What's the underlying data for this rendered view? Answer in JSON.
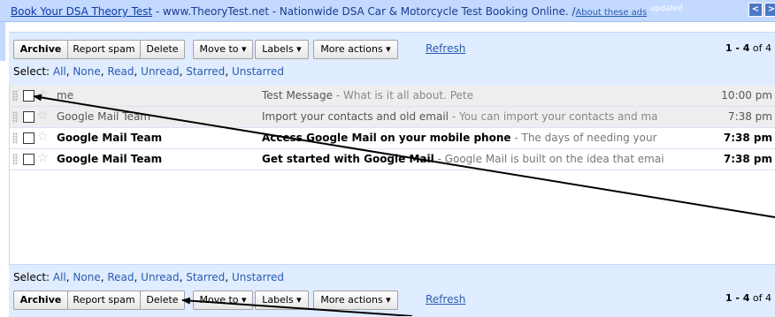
{
  "ad": {
    "link_text": "Book Your DSA Theory Test",
    "body": " - www.TheoryTest.net - Nationwide DSA Car & Motorcycle Test Booking Online. /",
    "about_text": "About these ads",
    "updated_text": "updated",
    "prev_icon": "chevron-left-icon",
    "next_icon": "chevron-right-icon"
  },
  "toolbar": {
    "archive": "Archive",
    "report_spam": "Report spam",
    "delete": "Delete",
    "move_to": "Move to ▾",
    "labels": "Labels ▾",
    "more_actions": "More actions ▾",
    "refresh": "Refresh",
    "count_range": "1 - 4",
    "count_total": "of 4"
  },
  "select": {
    "prefix": "Select: ",
    "all": "All",
    "none": "None",
    "read": "Read",
    "unread": "Unread",
    "starred": "Starred",
    "unstarred": "Unstarred",
    "sep": ", "
  },
  "messages": [
    {
      "sender": "me",
      "subject": "Test Message",
      "snippet": " - What is it all about. Pete",
      "time": "10:00 pm",
      "unread": false
    },
    {
      "sender": "Google Mail Team",
      "subject": "Import your contacts and old email",
      "snippet": " - You can import your contacts and ma",
      "time": "7:38 pm",
      "unread": false
    },
    {
      "sender": "Google Mail Team",
      "subject": "Access Google Mail on your mobile phone",
      "snippet": " - The days of needing your",
      "time": "7:38 pm",
      "unread": true
    },
    {
      "sender": "Google Mail Team",
      "subject": "Get started with Google Mail",
      "snippet": " - Google Mail is built on the idea that emai",
      "time": "7:38 pm",
      "unread": true
    }
  ],
  "colors": {
    "ad_bar": "#c3d9ff",
    "panel": "#e0ecff",
    "link": "#2a5db0",
    "read_row": "#eeeeee",
    "arrow": "#000000"
  }
}
